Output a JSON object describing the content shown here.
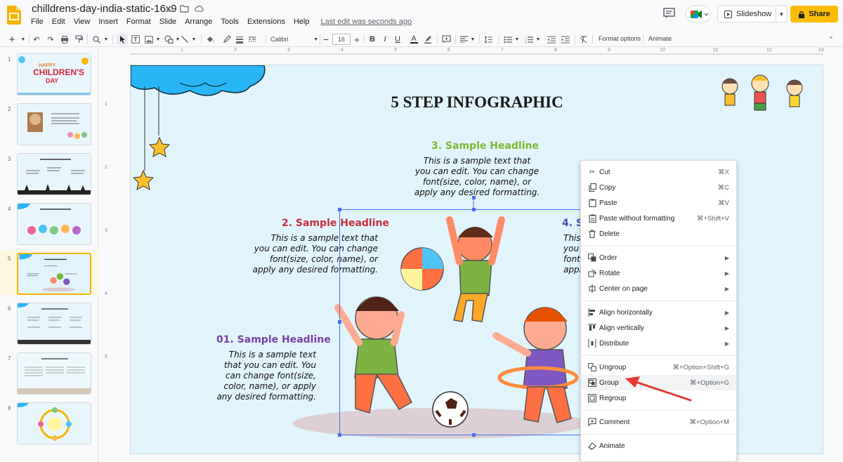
{
  "app": {
    "doc_title": "chilldrens-day-india-static-16x9",
    "menus": [
      "File",
      "Edit",
      "View",
      "Insert",
      "Format",
      "Slide",
      "Arrange",
      "Tools",
      "Extensions",
      "Help"
    ],
    "last_edit": "Last edit was seconds ago",
    "slideshow_label": "Slideshow",
    "share_label": "Share"
  },
  "toolbar": {
    "font": "Calibri",
    "font_size": "16",
    "format_options": "Format options",
    "animate": "Animate"
  },
  "ruler": {
    "h_ticks": [
      "1",
      "2",
      "3",
      "4",
      "5",
      "6",
      "7",
      "8",
      "9",
      "10",
      "11",
      "12",
      "13"
    ],
    "v_ticks": [
      "1",
      "2",
      "3",
      "4",
      "5"
    ]
  },
  "filmstrip": {
    "slides": [
      "1",
      "2",
      "3",
      "4",
      "5",
      "6",
      "7",
      "8"
    ],
    "selected": "5"
  },
  "slide": {
    "title": "5 STEP INFOGRAPHIC",
    "h3": "3. Sample Headline",
    "t3": [
      "This is a sample text that",
      "you can edit. You can change",
      "font(size, color, name), or",
      "apply any desired formatting."
    ],
    "h2": "2. Sample Headline",
    "t2": [
      "This is a sample text that",
      "you can edit. You can change",
      "font(size, color, name), or",
      "apply any desired formatting."
    ],
    "h1": "01. Sample Headline",
    "t1": [
      "This is a sample text",
      "that you can edit. You",
      "can change font(size,",
      "color, name), or apply",
      "any desired formatting."
    ],
    "h4": "4. S",
    "t4": [
      "This",
      "you c",
      "font(",
      "apply"
    ],
    "colors": {
      "h1": "#7b3fa8",
      "h2": "#c62f3f",
      "h3": "#7cb82f",
      "h4": "#4b4fa6"
    }
  },
  "context_menu": {
    "items": [
      {
        "label": "Cut",
        "shortcut": "⌘X",
        "icon": "scissors-icon"
      },
      {
        "label": "Copy",
        "shortcut": "⌘C",
        "icon": "copy-icon"
      },
      {
        "label": "Paste",
        "shortcut": "⌘V",
        "icon": "paste-icon"
      },
      {
        "label": "Paste without formatting",
        "shortcut": "⌘+Shift+V",
        "icon": "paste-plain-icon"
      },
      {
        "label": "Delete",
        "shortcut": "",
        "icon": "trash-icon"
      },
      {
        "label": "Order",
        "shortcut": "",
        "icon": "order-icon",
        "submenu": true
      },
      {
        "label": "Rotate",
        "shortcut": "",
        "icon": "rotate-icon",
        "submenu": true
      },
      {
        "label": "Center on page",
        "shortcut": "",
        "icon": "center-icon",
        "submenu": true
      },
      {
        "label": "Align horizontally",
        "shortcut": "",
        "icon": "align-h-icon",
        "submenu": true
      },
      {
        "label": "Align vertically",
        "shortcut": "",
        "icon": "align-v-icon",
        "submenu": true
      },
      {
        "label": "Distribute",
        "shortcut": "",
        "icon": "distribute-icon",
        "submenu": true
      },
      {
        "label": "Ungroup",
        "shortcut": "⌘+Option+Shift+G",
        "icon": "ungroup-icon"
      },
      {
        "label": "Group",
        "shortcut": "⌘+Option+G",
        "icon": "group-icon",
        "highlighted": true
      },
      {
        "label": "Regroup",
        "shortcut": "",
        "icon": "regroup-icon"
      },
      {
        "label": "Comment",
        "shortcut": "⌘+Option+M",
        "icon": "comment-icon"
      },
      {
        "label": "Animate",
        "shortcut": "",
        "icon": "animate-icon"
      }
    ]
  },
  "annotation": {
    "arrow_color": "#e53935"
  }
}
